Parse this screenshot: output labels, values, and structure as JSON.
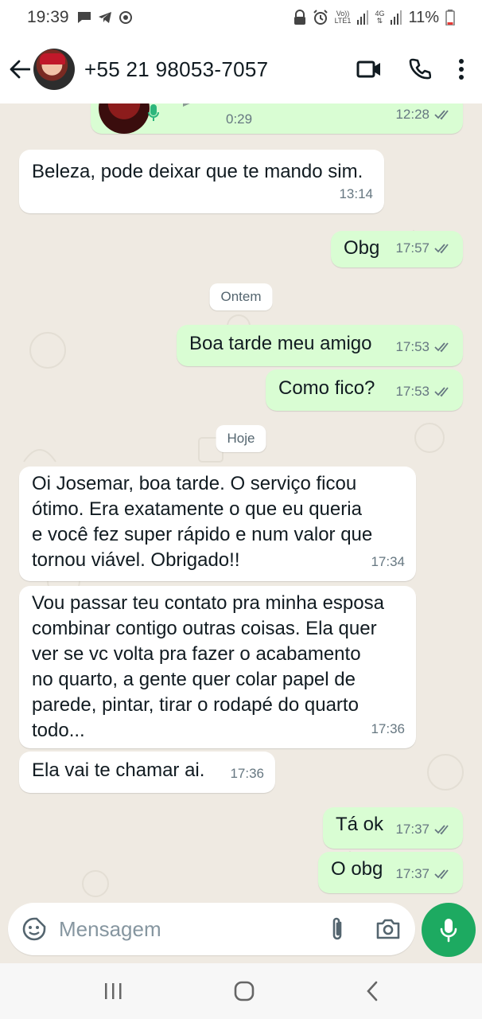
{
  "status_bar": {
    "time": "19:39",
    "network_top": "Vo))",
    "network_bottom": "LTE1",
    "net_4g": "4G",
    "battery": "11%"
  },
  "header": {
    "contact": "+55 21 98053-7057",
    "icons": [
      "back-arrow-icon",
      "video-call-icon",
      "phone-icon",
      "more-vert-icon"
    ]
  },
  "messages": [
    {
      "id": "audio",
      "direction": "out",
      "duration": "0:29",
      "time": "12:28"
    },
    {
      "id": "m1",
      "direction": "in",
      "lines": [
        "Beleza, pode deixar que te mando sim."
      ],
      "time": "13:14"
    },
    {
      "id": "m2",
      "direction": "out",
      "lines": [
        "Obg"
      ],
      "time": "17:57"
    },
    {
      "id": "m3",
      "direction": "out",
      "lines": [
        "Boa tarde meu amigo"
      ],
      "time": "17:53"
    },
    {
      "id": "m4",
      "direction": "out",
      "lines": [
        "Como fico?"
      ],
      "time": "17:53"
    },
    {
      "id": "m5",
      "direction": "in",
      "lines": [
        "Oi Josemar, boa tarde. O serviço ficou",
        "ótimo. Era exatamente o que eu queria",
        "e você fez super rápido e num valor que",
        "tornou viável. Obrigado!!"
      ],
      "time": "17:34"
    },
    {
      "id": "m6",
      "direction": "in",
      "lines": [
        "Vou passar teu contato pra minha esposa",
        "combinar contigo outras coisas. Ela quer",
        "ver se vc volta pra fazer o acabamento",
        "no quarto, a gente quer colar papel de",
        "parede, pintar, tirar o rodapé do quarto",
        "todo..."
      ],
      "time": "17:36"
    },
    {
      "id": "m7",
      "direction": "in",
      "lines": [
        "Ela vai te chamar ai."
      ],
      "time": "17:36"
    },
    {
      "id": "m8",
      "direction": "out",
      "lines": [
        "Tá ok"
      ],
      "time": "17:37"
    },
    {
      "id": "m9",
      "direction": "out",
      "lines": [
        "O obg"
      ],
      "time": "17:37"
    }
  ],
  "date_chips": {
    "yesterday": "Ontem",
    "today": "Hoje"
  },
  "input": {
    "placeholder": "Mensagem"
  },
  "colors": {
    "outgoing_bubble": "#d9fdd3",
    "incoming_bubble": "#ffffff",
    "chat_bg": "#efeae2",
    "accent": "#1daa61",
    "read_ticks": "#667781"
  }
}
